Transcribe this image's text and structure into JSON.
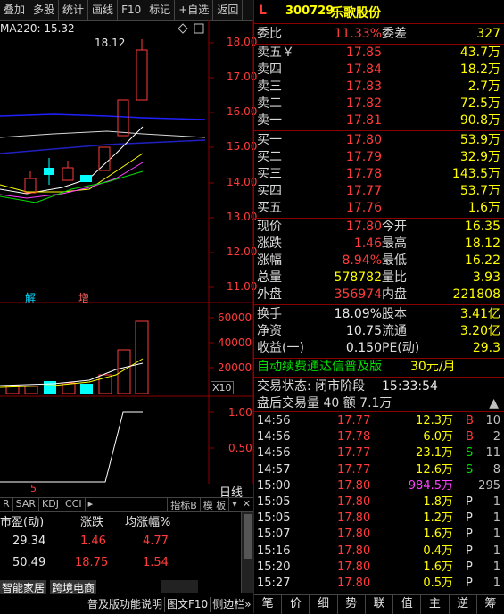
{
  "toolbar": [
    "叠加",
    "多股",
    "统计",
    "画线",
    "F10",
    "标记",
    "+自选",
    "返回"
  ],
  "chart": {
    "ma_label": "MA220: 15.32",
    "high_label": "18.12",
    "price_axis": [
      "18.00",
      "17.00",
      "16.00",
      "15.00",
      "14.00",
      "13.00",
      "12.00",
      "11.00"
    ],
    "markers": [
      "解",
      "增"
    ],
    "vol_axis": [
      "60000",
      "40000",
      "20000"
    ],
    "vol_unit": "X10",
    "ind_axis": [
      "1.00",
      "0.50"
    ],
    "day_label": "5",
    "period_label": "日线"
  },
  "bottom_left": {
    "tabs": [
      "R",
      "SAR",
      "KDJ",
      "CCI"
    ],
    "index_btn": "指标B",
    "template_btn": "模 板",
    "table_headers": [
      "市盈(动)",
      "涨跌",
      "均涨幅%"
    ],
    "rows": [
      {
        "pe": "29.34",
        "chg": "1.46",
        "avg": "4.77"
      },
      {
        "pe": "50.49",
        "chg": "18.75",
        "avg": "1.54"
      }
    ],
    "sectors": [
      "智能家居",
      "跨境电商"
    ],
    "status_bar": [
      "普及版功能说明",
      "图文F10",
      "侧边栏»"
    ]
  },
  "header": {
    "tag": "L",
    "code": "300729",
    "name": "乐歌股份"
  },
  "ratio": {
    "wb_label": "委比",
    "wb": "11.33%",
    "wc_label": "委差",
    "wc": "327"
  },
  "asks": [
    {
      "label": "卖五￥",
      "price": "17.85",
      "vol": "43.7万"
    },
    {
      "label": "卖四",
      "price": "17.84",
      "vol": "18.2万"
    },
    {
      "label": "卖三",
      "price": "17.83",
      "vol": "2.7万"
    },
    {
      "label": "卖二",
      "price": "17.82",
      "vol": "72.5万"
    },
    {
      "label": "卖一",
      "price": "17.81",
      "vol": "90.8万"
    }
  ],
  "bids": [
    {
      "label": "买一",
      "price": "17.80",
      "vol": "53.9万"
    },
    {
      "label": "买二",
      "price": "17.79",
      "vol": "32.9万"
    },
    {
      "label": "买三",
      "price": "17.78",
      "vol": "143.5万"
    },
    {
      "label": "买四",
      "price": "17.77",
      "vol": "53.7万"
    },
    {
      "label": "买五",
      "price": "17.76",
      "vol": "1.6万"
    }
  ],
  "stats": [
    {
      "l1": "现价",
      "v1": "17.80",
      "l2": "今开",
      "v2": "16.35"
    },
    {
      "l1": "涨跌",
      "v1": "1.46",
      "l2": "最高",
      "v2": "18.12"
    },
    {
      "l1": "涨幅",
      "v1": "8.94%",
      "l2": "最低",
      "v2": "16.22"
    },
    {
      "l1": "总量",
      "v1": "578782",
      "l2": "量比",
      "v2": "3.93"
    },
    {
      "l1": "外盘",
      "v1": "356974",
      "l2": "内盘",
      "v2": "221808"
    }
  ],
  "stats2": [
    {
      "l1": "换手",
      "v1": "18.09%",
      "l2": "股本",
      "v2": "3.41亿"
    },
    {
      "l1": "净资",
      "v1": "10.75",
      "l2": "流通",
      "v2": "3.20亿"
    },
    {
      "l1": "收益(一)",
      "v1": "0.150",
      "l2": "PE(动)",
      "v2": "29.3"
    }
  ],
  "promo": {
    "text": "自动续费通达信普及版",
    "price": "30元/月"
  },
  "trade_state": {
    "label": "交易状态: 闭市阶段",
    "time": "15:33:54"
  },
  "after_hours": "盘后交易量 40 额 7.1万",
  "ticks": [
    {
      "t": "14:56",
      "p": "17.77",
      "v": "12.3万",
      "bs": "B",
      "n": "10"
    },
    {
      "t": "14:56",
      "p": "17.78",
      "v": "6.0万",
      "bs": "B",
      "n": "2"
    },
    {
      "t": "14:56",
      "p": "17.77",
      "v": "23.1万",
      "bs": "S",
      "n": "11"
    },
    {
      "t": "14:57",
      "p": "17.77",
      "v": "12.6万",
      "bs": "S",
      "n": "8"
    },
    {
      "t": "15:00",
      "p": "17.80",
      "v": "984.5万",
      "bs": "",
      "n": "295"
    },
    {
      "t": "15:05",
      "p": "17.80",
      "v": "1.8万",
      "bs": "P",
      "n": "1"
    },
    {
      "t": "15:05",
      "p": "17.80",
      "v": "1.2万",
      "bs": "P",
      "n": "1"
    },
    {
      "t": "15:07",
      "p": "17.80",
      "v": "1.6万",
      "bs": "P",
      "n": "1"
    },
    {
      "t": "15:16",
      "p": "17.80",
      "v": "0.4万",
      "bs": "P",
      "n": "1"
    },
    {
      "t": "15:20",
      "p": "17.80",
      "v": "1.6万",
      "bs": "P",
      "n": "1"
    },
    {
      "t": "15:27",
      "p": "17.80",
      "v": "0.5万",
      "bs": "P",
      "n": "1"
    }
  ],
  "bottom_nav": [
    "笔",
    "价",
    "细",
    "势",
    "联",
    "值",
    "主",
    "逆",
    "筹"
  ],
  "colors": {
    "up": "#ff3b3b",
    "down": "#00e000",
    "vol": "#ffff00",
    "cyan": "#00ffff",
    "border": "#8b0000"
  }
}
